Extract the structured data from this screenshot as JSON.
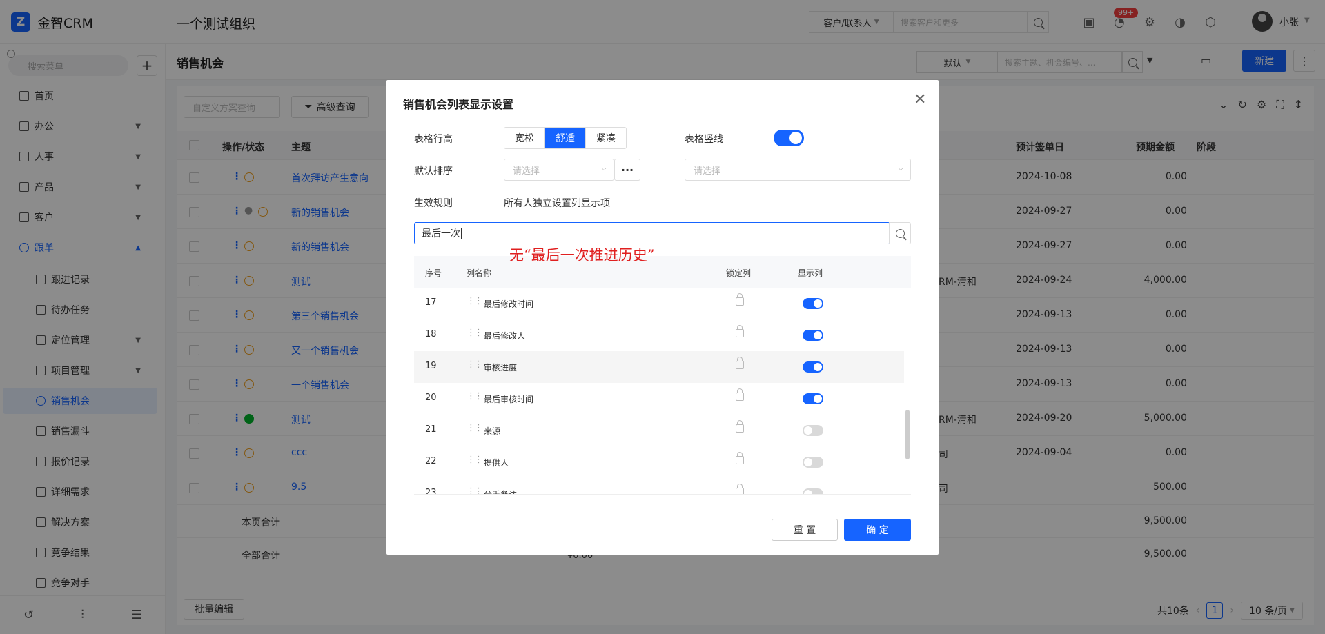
{
  "app": {
    "name": "金智CRM",
    "org_title": "一个测试组织",
    "search_scope": "客户/联系人",
    "search_placeholder": "搜索客户和更多",
    "notification_badge": "99+",
    "user_name": "小张"
  },
  "sidebar": {
    "search_placeholder": "搜索菜单",
    "items": [
      {
        "label": "首页",
        "icon": "dashboard-icon"
      },
      {
        "label": "办公",
        "icon": "office-icon"
      },
      {
        "label": "人事",
        "icon": "people-icon"
      },
      {
        "label": "产品",
        "icon": "product-icon"
      },
      {
        "label": "客户",
        "icon": "customer-icon"
      },
      {
        "label": "跟单",
        "icon": "follow-icon"
      },
      {
        "label": "跟进记录",
        "icon": "record-icon"
      },
      {
        "label": "待办任务",
        "icon": "pin-icon"
      },
      {
        "label": "定位管理",
        "icon": "location-icon"
      },
      {
        "label": "项目管理",
        "icon": "project-icon"
      },
      {
        "label": "销售机会",
        "icon": "opportunity-icon"
      },
      {
        "label": "销售漏斗",
        "icon": "funnel-icon"
      },
      {
        "label": "报价记录",
        "icon": "quote-icon"
      },
      {
        "label": "详细需求",
        "icon": "requirement-icon"
      },
      {
        "label": "解决方案",
        "icon": "bulb-icon"
      },
      {
        "label": "竞争结果",
        "icon": "result-icon"
      },
      {
        "label": "竞争对手",
        "icon": "rival-icon"
      }
    ]
  },
  "page": {
    "title": "销售机会",
    "view_select": "默认",
    "search_placeholder": "搜索主题、机会编号、...",
    "new_button": "新建",
    "filter_placeholder": "自定义方案查询",
    "advanced_query": "高级查询",
    "columns": {
      "action": "操作/状态",
      "subject": "主题",
      "expected_date": "预计签单日",
      "expected_amount": "预期金额",
      "stage": "阶段"
    },
    "rows": [
      {
        "subject": "首次拜访产生意向",
        "extra": "",
        "date": "2024-10-08",
        "amount": "0.00",
        "status": "pending"
      },
      {
        "subject": "新的销售机会",
        "extra": "",
        "date": "2024-09-27",
        "amount": "0.00",
        "status": "pending"
      },
      {
        "subject": "新的销售机会",
        "extra": "",
        "date": "2024-09-27",
        "amount": "0.00",
        "status": "pending"
      },
      {
        "subject": "测试",
        "extra": "RM-清和",
        "date": "2024-09-24",
        "amount": "4,000.00",
        "status": "pending"
      },
      {
        "subject": "第三个销售机会",
        "extra": "",
        "date": "2024-09-13",
        "amount": "0.00",
        "status": "pending"
      },
      {
        "subject": "又一个销售机会",
        "extra": "",
        "date": "2024-09-13",
        "amount": "0.00",
        "status": "pending"
      },
      {
        "subject": "一个销售机会",
        "extra": "",
        "date": "2024-09-13",
        "amount": "0.00",
        "status": "pending"
      },
      {
        "subject": "测试",
        "extra": "RM-清和",
        "date": "2024-09-20",
        "amount": "5,000.00",
        "status": "done"
      },
      {
        "subject": "ccc",
        "extra": "司",
        "date": "2024-09-04",
        "amount": "0.00",
        "status": "pending"
      },
      {
        "subject": "9.5",
        "extra": "司",
        "date": "",
        "amount": "500.00",
        "status": "pending"
      }
    ],
    "page_total_label": "本页合计",
    "page_total_amount": "9,500.00",
    "all_total_label": "全部合计",
    "all_total_mid": "¥0.00",
    "all_total_amount": "9,500.00",
    "bulk_edit": "批量编辑",
    "total_count": "共10条",
    "current_page": "1",
    "page_size": "10 条/页"
  },
  "modal": {
    "title": "销售机会列表显示设置",
    "row_height_label": "表格行高",
    "row_height_options": [
      "宽松",
      "舒适",
      "紧凑"
    ],
    "row_height_selected": "舒适",
    "vertical_lines_label": "表格竖线",
    "vertical_lines_on": true,
    "default_sort_label": "默认排序",
    "sort_placeholder": "请选择",
    "sort_order_placeholder": "请选择",
    "rule_label": "生效规则",
    "rule_value": "所有人独立设置列显示项",
    "column_search_value": "最后一次",
    "annotation": "无“最后一次推进历史”",
    "table_headers": {
      "seq": "序号",
      "name": "列名称",
      "lock": "锁定列",
      "show": "显示列"
    },
    "columns": [
      {
        "seq": "17",
        "name": "最后修改时间",
        "show": true
      },
      {
        "seq": "18",
        "name": "最后修改人",
        "show": true
      },
      {
        "seq": "19",
        "name": "审核进度",
        "show": true
      },
      {
        "seq": "20",
        "name": "最后审核时间",
        "show": true
      },
      {
        "seq": "21",
        "name": "来源",
        "show": false
      },
      {
        "seq": "22",
        "name": "提供人",
        "show": false
      },
      {
        "seq": "23",
        "name": "分手备注",
        "show": false
      }
    ],
    "reset_button": "重 置",
    "ok_button": "确 定"
  },
  "colors": {
    "primary": "#1664ff",
    "annotation": "#e02020",
    "badge": "#f53f3f"
  }
}
